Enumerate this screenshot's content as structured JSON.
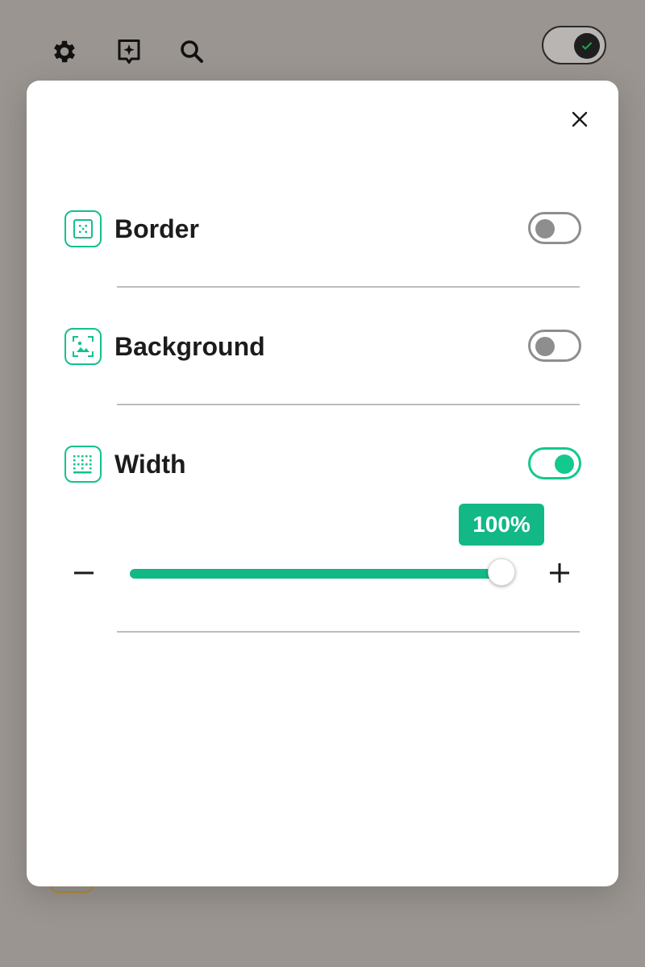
{
  "toolbar": {
    "icons": [
      "gear-icon",
      "sparkle-bookmark-icon",
      "search-icon"
    ],
    "theme_toggle": {
      "state": "on",
      "icon": "check-icon"
    }
  },
  "modal": {
    "close_icon": "close-icon",
    "rows": [
      {
        "label": "Border",
        "icon": "border-icon",
        "enabled": false
      },
      {
        "label": "Background",
        "icon": "background-image-icon",
        "enabled": false
      },
      {
        "label": "Width",
        "icon": "width-icon",
        "enabled": true
      }
    ],
    "width_slider": {
      "value_label": "100%",
      "value_percent": 100,
      "minus_icon": "minus-icon",
      "plus_icon": "plus-icon"
    }
  },
  "colors": {
    "accent": "#12b886",
    "toggle_on": "#13c98d",
    "toggle_off": "#8e8e8e",
    "overlay": "#9a9590",
    "modal_bg": "#ffffff"
  }
}
